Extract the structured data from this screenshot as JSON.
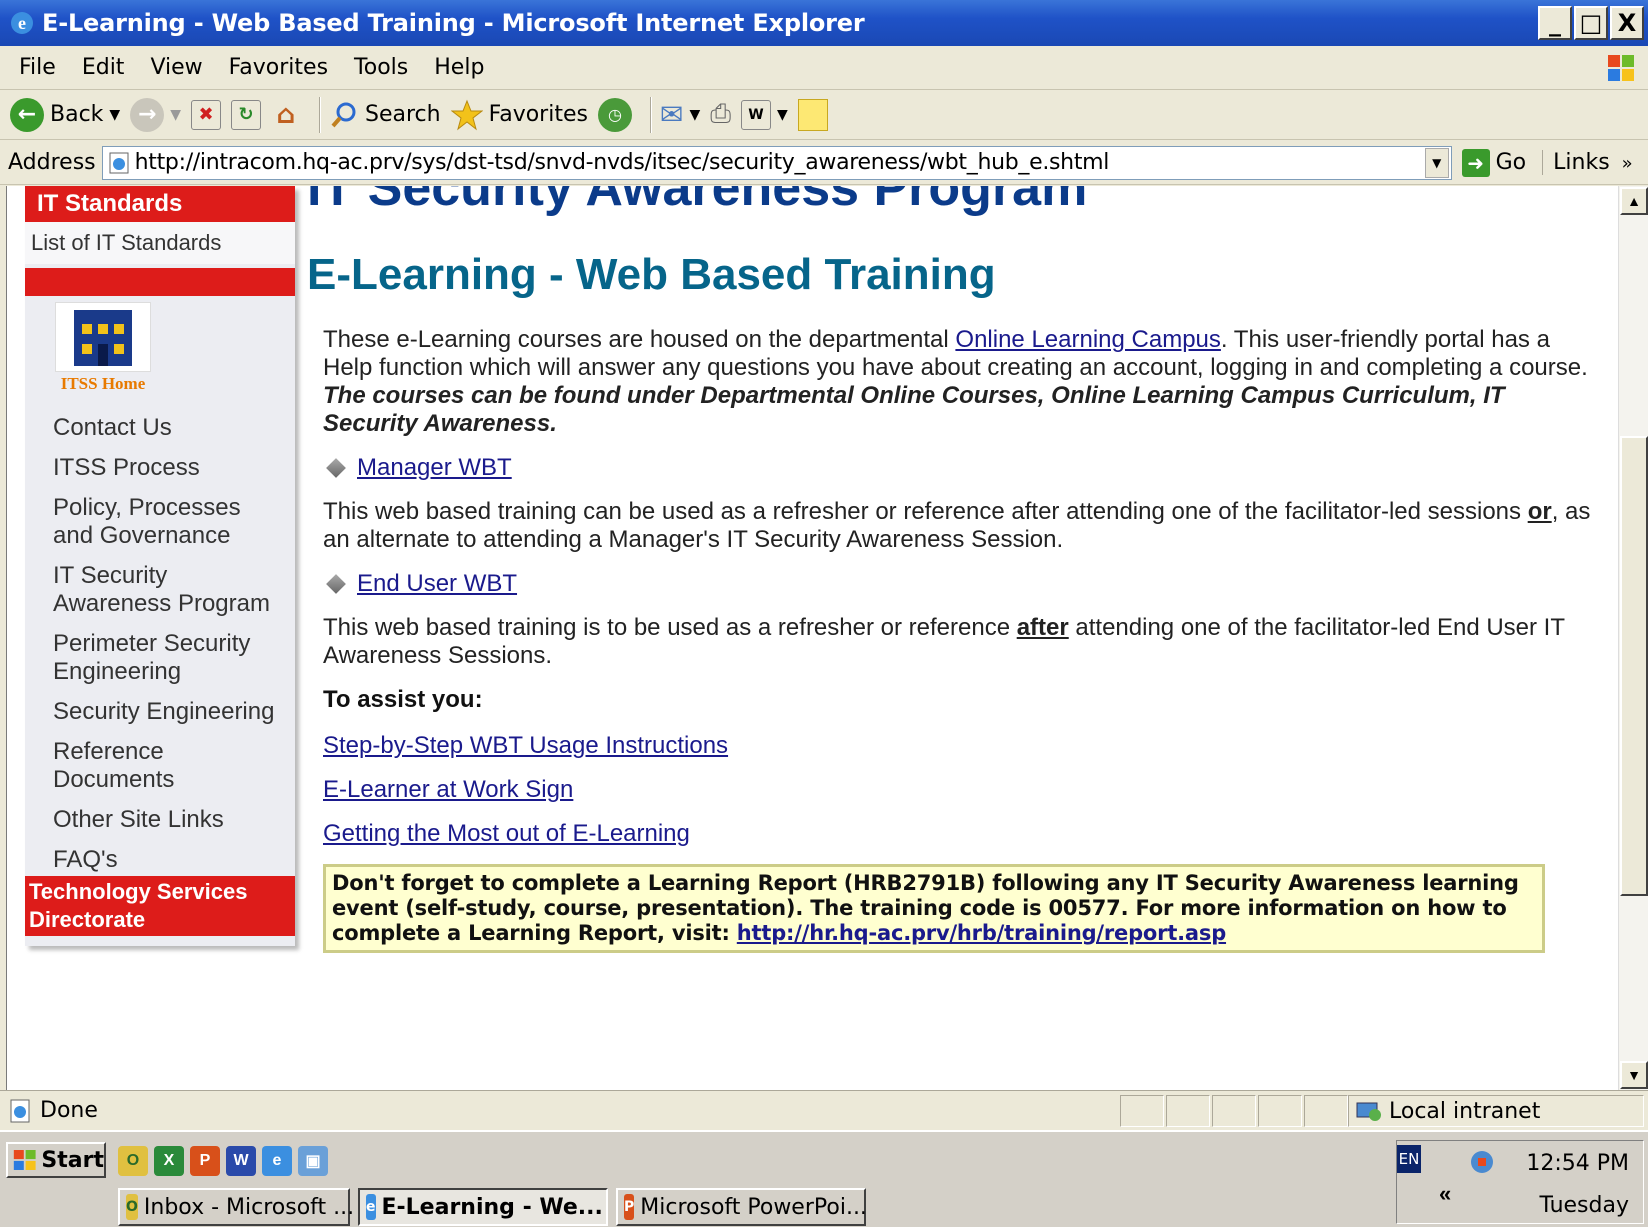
{
  "window": {
    "title": "E-Learning - Web Based Training - Microsoft Internet Explorer",
    "controls": [
      "_",
      "□",
      "X"
    ]
  },
  "menu": [
    "File",
    "Edit",
    "View",
    "Favorites",
    "Tools",
    "Help"
  ],
  "toolbar": {
    "back": "Back",
    "search": "Search",
    "favorites": "Favorites"
  },
  "address": {
    "label": "Address",
    "url": "http://intracom.hq-ac.prv/sys/dst-tsd/snvd-nvds/itsec/security_awareness/wbt_hub_e.shtml",
    "go": "Go",
    "links": "Links"
  },
  "sidebar": {
    "section_header": "IT Standards",
    "sub_link": "List of IT Standards",
    "home_label": "ITSS Home",
    "items": [
      "Contact Us",
      "ITSS Process",
      "Policy, Processes and Governance",
      "IT Security Awareness Program",
      "Perimeter Security Engineering",
      "Security Engineering",
      "Reference Documents",
      "Other Site Links",
      "FAQ's"
    ],
    "footer": "Technology Services Directorate"
  },
  "content": {
    "program_title": "IT Security Awareness Program",
    "page_title": "E-Learning - Web Based Training",
    "intro_pre": "These e-Learning courses are housed on the departmental ",
    "intro_link": "Online Learning Campus",
    "intro_post": ". This user-friendly portal has a Help function which will answer any questions you have about creating an account, logging in and completing a course. ",
    "intro_bold": "The courses can be found under Departmental Online Courses, Online Learning Campus Curriculum, IT Security Awareness.",
    "manager_link": "Manager WBT",
    "manager_desc_pre": "This web based training can be used as a refresher or reference after attending one of the facilitator-led sessions ",
    "manager_desc_or": "or",
    "manager_desc_post": ", as an alternate to attending a Manager's IT Security Awareness Session.",
    "enduser_link": "End User WBT",
    "enduser_desc_pre": "This web based training is to be used as a refresher or reference ",
    "enduser_desc_after": "after",
    "enduser_desc_post": " attending one of the facilitator-led End User IT Awareness Sessions.",
    "assist_heading": "To assist you:",
    "assist_links": [
      "Step-by-Step WBT Usage Instructions",
      "E-Learner at Work Sign",
      "Getting the Most out of E-Learning"
    ],
    "notice_text": "Don't forget to complete a Learning Report (HRB2791B) following any IT Security Awareness learning event (self-study, course, presentation). The training code is 00577. For more information on how to complete a Learning Report, visit: ",
    "notice_link": "http://hr.hq-ac.prv/hrb/training/report.asp"
  },
  "status": {
    "text": "Done",
    "zone": "Local intranet"
  },
  "taskbar": {
    "start": "Start",
    "buttons": [
      "Inbox - Microsoft ...",
      "E-Learning - We...",
      "Microsoft PowerPoi..."
    ],
    "lang": "EN",
    "time": "12:54 PM",
    "day": "Tuesday"
  },
  "colors": {
    "nav_red": "#dd1c1a",
    "heading_blue": "#0b3b8a",
    "title_teal": "#06658a",
    "notice_bg": "#ffffd0"
  }
}
